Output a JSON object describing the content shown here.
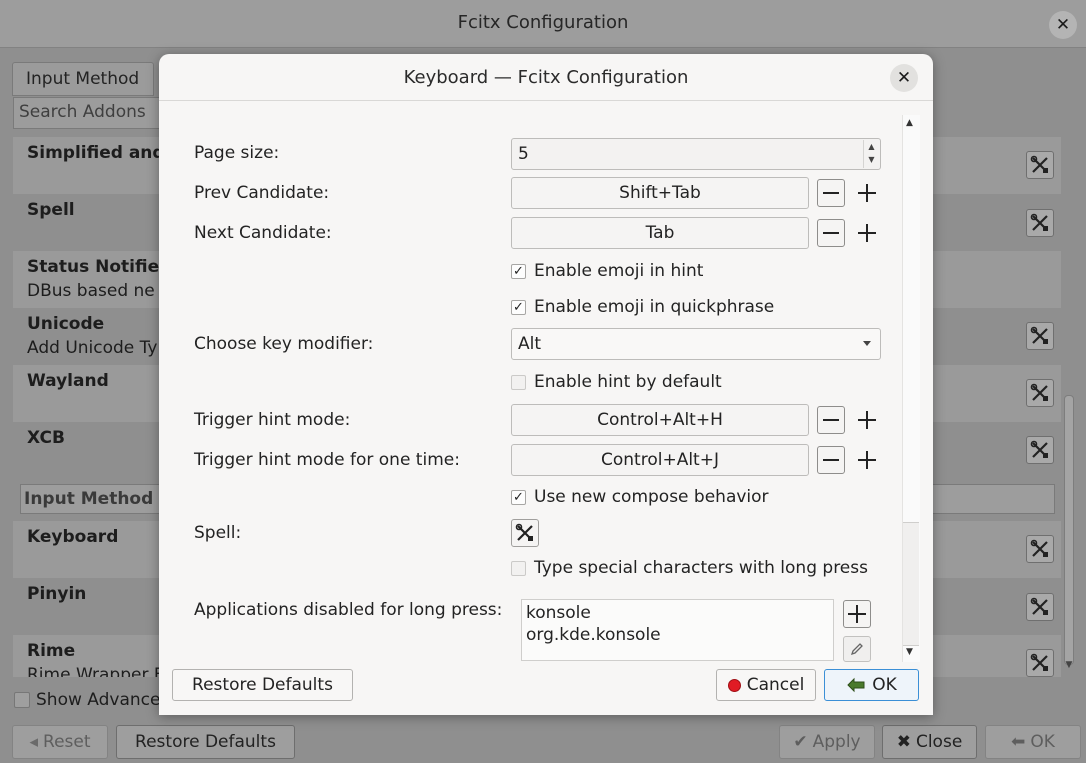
{
  "main": {
    "title": "Fcitx Configuration",
    "tab": "Input Method",
    "search_placeholder": "Search Addons",
    "addons_top": [
      {
        "name": "Simplified and ",
        "desc": ""
      },
      {
        "name": "Spell",
        "desc": ""
      },
      {
        "name": "Status Notifier",
        "desc": "DBus based ne"
      },
      {
        "name": "Unicode",
        "desc": "Add Unicode Ty"
      },
      {
        "name": "Wayland",
        "desc": ""
      },
      {
        "name": "XCB",
        "desc": ""
      }
    ],
    "group_header": "Input Method",
    "addons_bottom": [
      {
        "name": "Keyboard",
        "desc": ""
      },
      {
        "name": "Pinyin",
        "desc": ""
      },
      {
        "name": "Rime",
        "desc": "Rime Wrapper F"
      }
    ],
    "show_advanced": "Show Advance",
    "buttons": {
      "reset": "Reset",
      "restore_defaults": "Restore Defaults",
      "apply": "Apply",
      "close": "Close",
      "ok": "OK"
    }
  },
  "dialog": {
    "title": "Keyboard — Fcitx Configuration",
    "page_size_label": "Page size:",
    "page_size_value": "5",
    "prev_label": "Prev Candidate:",
    "prev_key": "Shift+Tab",
    "next_label": "Next Candidate:",
    "next_key": "Tab",
    "emoji_hint": "Enable emoji in hint",
    "emoji_quickphrase": "Enable emoji in quickphrase",
    "modifier_label": "Choose key modifier:",
    "modifier_value": "Alt",
    "hint_default": "Enable hint by default",
    "trigger_label": "Trigger hint mode:",
    "trigger_key": "Control+Alt+H",
    "trigger_once_label": "Trigger hint mode for one time:",
    "trigger_once_key": "Control+Alt+J",
    "compose": "Use new compose behavior",
    "spell_label": "Spell:",
    "long_press": "Type special characters with long press",
    "apps_label": "Applications disabled for long press:",
    "apps": [
      "konsole",
      "org.kde.konsole"
    ],
    "buttons": {
      "restore_defaults": "Restore Defaults",
      "cancel": "Cancel",
      "ok": "OK"
    }
  },
  "checkbox_states": {
    "emoji_hint": true,
    "emoji_quickphrase": true,
    "hint_default": false,
    "compose": true,
    "long_press": false
  },
  "icons": [
    "close-icon",
    "configure-icon",
    "minus-icon",
    "plus-icon",
    "pencil-icon",
    "check-icon",
    "cancel-icon",
    "ok-icon",
    "reset-icon",
    "apply-icon"
  ],
  "colors": {
    "ok_focus": "#3b8fd6",
    "cancel_dot": "#e01b24"
  }
}
